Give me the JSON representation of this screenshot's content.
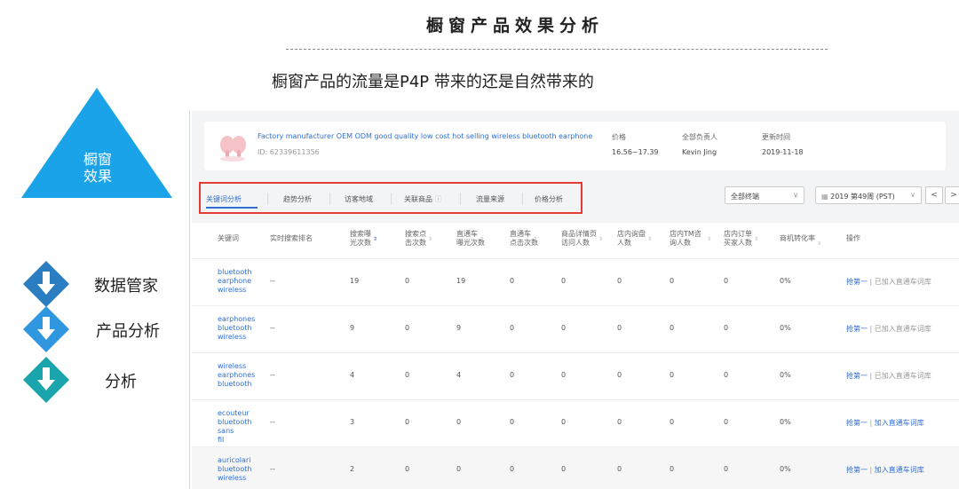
{
  "slide": {
    "title": "橱窗产品效果分析",
    "subtitle": "橱窗产品的流量是P4P 带来的还是自然带来的",
    "triangle_label": "橱窗\n效果",
    "menu": [
      {
        "label": "数据管家",
        "color": "#2b7dc2",
        "icon": "arrow-down-icon"
      },
      {
        "label": "产品分析",
        "color": "#2f97e0",
        "icon": "arrow-down-icon"
      },
      {
        "label": "分析",
        "color": "#1aa5ad",
        "icon": "arrow-down-icon"
      }
    ],
    "triangle_color": "#1aa3e8"
  },
  "product": {
    "title": "Factory manufacturer OEM ODM good quality low cost hot selling wireless bluetooth earphone",
    "id": "ID: 62339611356",
    "price_label": "价格",
    "price": "16.56~17.39",
    "owner_label": "全部负责人",
    "owner": "Kevin Jing",
    "updated_label": "更新时间",
    "updated": "2019-11-18"
  },
  "tabs": [
    "关键词分析",
    "趋势分析",
    "访客地域",
    "关联商品",
    "流量来源",
    "价格分析"
  ],
  "filters": {
    "terminal": "全部终端",
    "week": "2019 第49周 (PST)",
    "prev": "<",
    "next": ">"
  },
  "table": {
    "headers": [
      "关键词",
      "实时搜索排名",
      "搜索曝\n光次数",
      "搜索点\n击次数",
      "直通车\n曝光次数",
      "直通车\n点击次数",
      "商品详情页\n访问人数",
      "店内询盘\n人数",
      "店内TM咨\n询人数",
      "店内订单\n买家人数",
      "商机转化率",
      "操作"
    ],
    "rows": [
      {
        "kw": "bluetooth\nearphone\nwireless",
        "rank": "--",
        "v": [
          "19",
          "0",
          "19",
          "0",
          "0",
          "0",
          "0",
          "0",
          "0%"
        ],
        "op_a": "抢第一",
        "op_b": "已加入直通车词库",
        "added": true
      },
      {
        "kw": "earphones\nbluetooth\nwireless",
        "rank": "--",
        "v": [
          "9",
          "0",
          "9",
          "0",
          "0",
          "0",
          "0",
          "0",
          "0%"
        ],
        "op_a": "抢第一",
        "op_b": "已加入直通车词库",
        "added": true
      },
      {
        "kw": "wireless\nearphones\nbluetooth",
        "rank": "--",
        "v": [
          "4",
          "0",
          "4",
          "0",
          "0",
          "0",
          "0",
          "0",
          "0%"
        ],
        "op_a": "抢第一",
        "op_b": "已加入直通车词库",
        "added": true
      },
      {
        "kw": "ecouteur\nbluetooth sans\nfil",
        "rank": "--",
        "v": [
          "3",
          "0",
          "0",
          "0",
          "0",
          "0",
          "0",
          "0",
          "0%"
        ],
        "op_a": "抢第一",
        "op_b": "加入直通车词库",
        "added": false
      },
      {
        "kw": "auricolari\nbluetooth\nwireless",
        "rank": "--",
        "v": [
          "2",
          "0",
          "0",
          "0",
          "0",
          "0",
          "0",
          "0",
          "0%"
        ],
        "op_a": "抢第一",
        "op_b": "加入直通车词库",
        "added": false
      }
    ]
  }
}
